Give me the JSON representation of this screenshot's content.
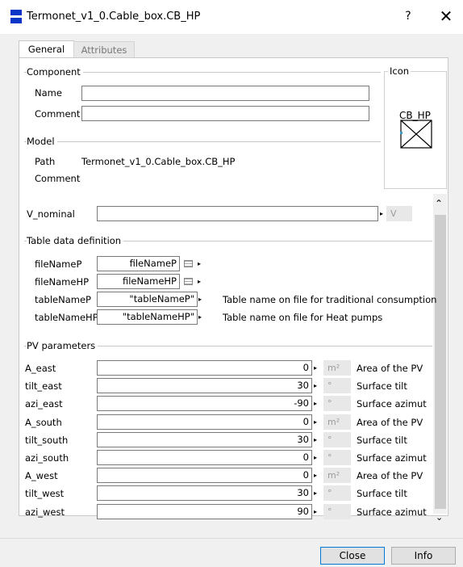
{
  "window": {
    "title": "Termonet_v1_0.Cable_box.CB_HP",
    "help_label": "?",
    "close_label": "✕"
  },
  "tabs": [
    "General",
    "Attributes"
  ],
  "component": {
    "group_label": "Component",
    "name_label": "Name",
    "name_value": "",
    "comment_label": "Comment",
    "comment_value": ""
  },
  "icon": {
    "group_label": "Icon",
    "caption": "CB_HP"
  },
  "model": {
    "group_label": "Model",
    "path_label": "Path",
    "path_value": "Termonet_v1_0.Cable_box.CB_HP",
    "comment_label": "Comment"
  },
  "v_nominal": {
    "label": "V_nominal",
    "value": "",
    "unit": "V"
  },
  "table_data": {
    "group_label": "Table data definition",
    "rows": [
      {
        "label": "fileNameP",
        "value": "fileNameP",
        "desc": ""
      },
      {
        "label": "fileNameHP",
        "value": "fileNameHP",
        "desc": ""
      },
      {
        "label": "tableNameP",
        "value": "\"tableNameP\"",
        "desc": "Table name on file for traditional consumption"
      },
      {
        "label": "tableNameHP",
        "value": "\"tableNameHP\"",
        "desc": "Table name on file for Heat pumps"
      }
    ]
  },
  "pv": {
    "group_label": "PV parameters",
    "rows": [
      {
        "label": "A_east",
        "value": "0",
        "unit": "m²",
        "desc": "Area of the PV"
      },
      {
        "label": "tilt_east",
        "value": "30",
        "unit": "°",
        "desc": "Surface tilt"
      },
      {
        "label": "azi_east",
        "value": "-90",
        "unit": "°",
        "desc": "Surface azimut"
      },
      {
        "label": "A_south",
        "value": "0",
        "unit": "m²",
        "desc": "Area of the PV"
      },
      {
        "label": "tilt_south",
        "value": "30",
        "unit": "°",
        "desc": "Surface tilt"
      },
      {
        "label": "azi_south",
        "value": "0",
        "unit": "°",
        "desc": "Surface azimut"
      },
      {
        "label": "A_west",
        "value": "0",
        "unit": "m²",
        "desc": "Area of the PV"
      },
      {
        "label": "tilt_west",
        "value": "30",
        "unit": "°",
        "desc": "Surface tilt"
      },
      {
        "label": "azi_west",
        "value": "90",
        "unit": "°",
        "desc": "Surface azimut"
      }
    ]
  },
  "buttons": {
    "close": "Close",
    "info": "Info"
  },
  "colors": {
    "accent": "#0078d7",
    "app_icon": "#0a36c8"
  }
}
